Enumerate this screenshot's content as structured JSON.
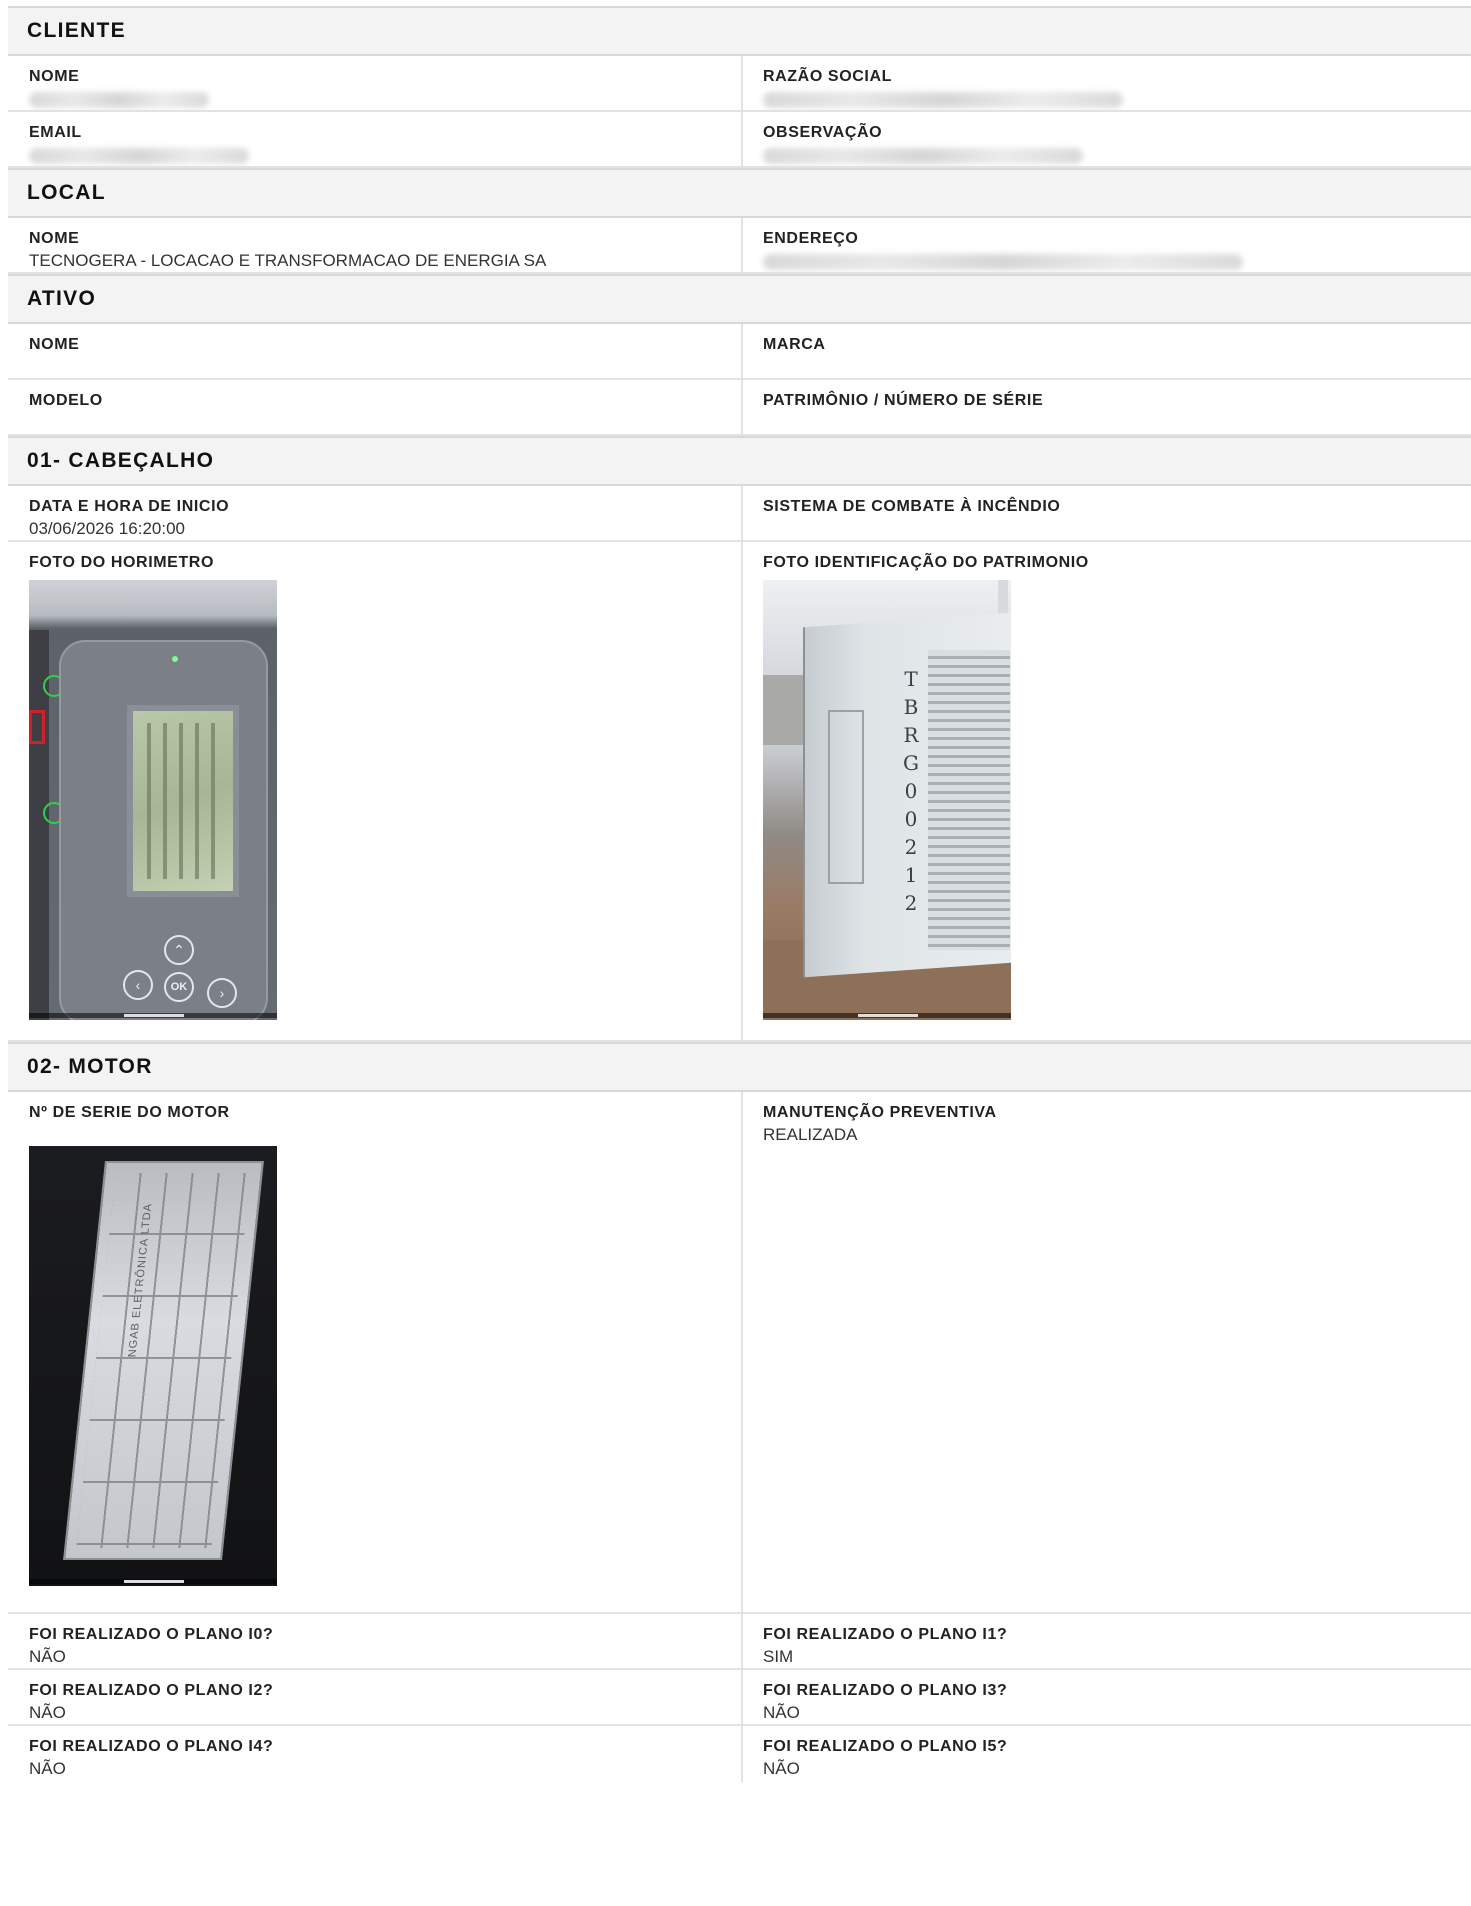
{
  "cliente": {
    "title": "CLIENTE",
    "nome_label": "NOME",
    "razao_label": "RAZÃO SOCIAL",
    "email_label": "EMAIL",
    "observacao_label": "OBSERVAÇÃO"
  },
  "local": {
    "title": "LOCAL",
    "nome_label": "NOME",
    "nome_value": "TECNOGERA - LOCACAO E TRANSFORMACAO DE ENERGIA SA",
    "endereco_label": "ENDEREÇO"
  },
  "ativo": {
    "title": "ATIVO",
    "nome_label": "NOME",
    "marca_label": "MARCA",
    "modelo_label": "MODELO",
    "patrimonio_label": "PATRIMÔNIO / NÚMERO DE SÉRIE"
  },
  "cabecalho": {
    "title": "01- CABEÇALHO",
    "data_label": "DATA E HORA DE INICIO",
    "data_value": "03/06/2026 16:20:00",
    "sistema_label": "SISTEMA DE COMBATE À INCÊNDIO",
    "foto_horimetro_label": "FOTO DO HORIMETRO",
    "foto_patrimonio_label": "FOTO IDENTIFICAÇÃO DO PATRIMONIO",
    "horimetro_button_ok": "OK",
    "patrimonio_id_text": "TBRG00212"
  },
  "motor": {
    "title": "02- MOTOR",
    "serie_label": "Nº DE SERIE DO MOTOR",
    "manutencao_label": "MANUTENÇÃO PREVENTIVA",
    "manutencao_value": "REALIZADA",
    "plate_text": "NGAB ELETRÔNICA LTDA",
    "planos": [
      {
        "label": "FOI REALIZADO O PLANO I0?",
        "value": "NÃO"
      },
      {
        "label": "FOI REALIZADO O PLANO I1?",
        "value": "SIM"
      },
      {
        "label": "FOI REALIZADO O PLANO I2?",
        "value": "NÃO"
      },
      {
        "label": "FOI REALIZADO O PLANO I3?",
        "value": "NÃO"
      },
      {
        "label": "FOI REALIZADO O PLANO I4?",
        "value": "NÃO"
      },
      {
        "label": "FOI REALIZADO O PLANO I5?",
        "value": "NÃO"
      }
    ]
  }
}
